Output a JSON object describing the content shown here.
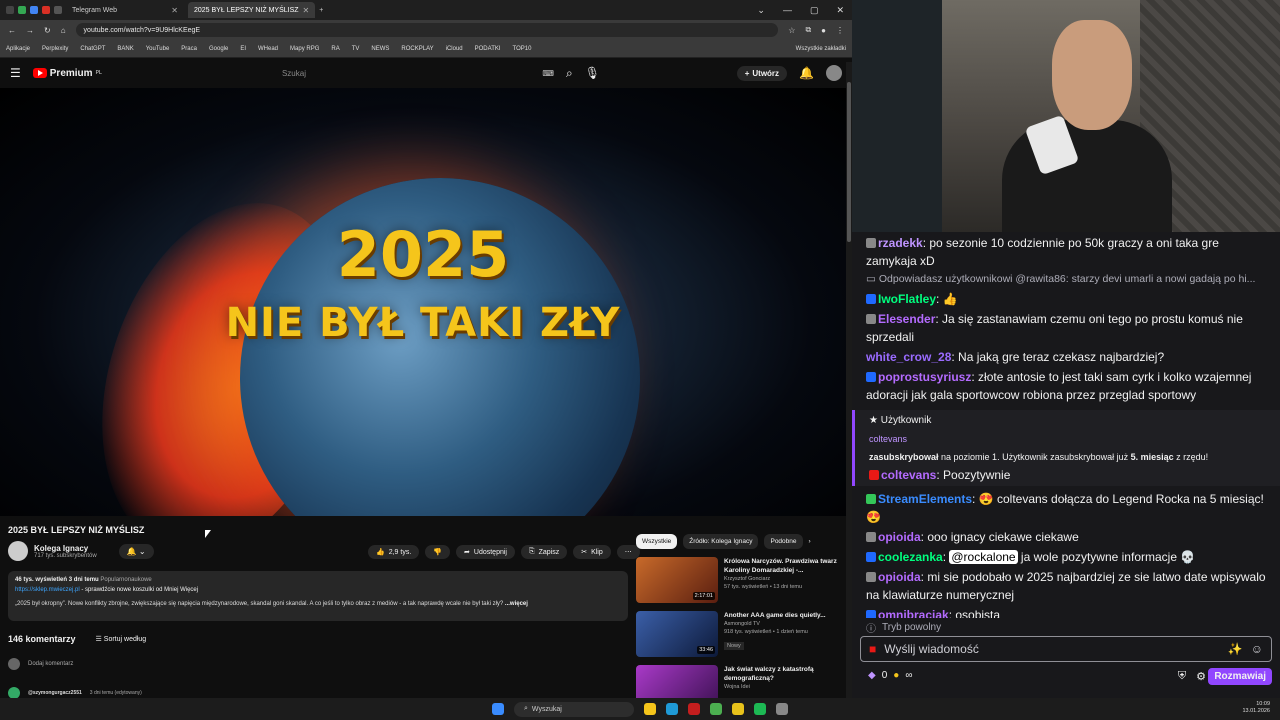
{
  "browser": {
    "tabs": [
      {
        "label": ""
      },
      {
        "label": ""
      },
      {
        "label": ""
      },
      {
        "label": ""
      },
      {
        "label": "Telegram Web"
      },
      {
        "label": "2025 BYŁ LEPSZY NIŻ MYŚLISZ"
      }
    ],
    "url": "youtube.com/watch?v=9U9HlcKEegE",
    "bookmarks": [
      "Aplikacje",
      "Perplexity",
      "ChatGPT",
      "BANK",
      "YouTube",
      "Praca",
      "Google",
      "EI",
      "WHead",
      "Mapy RPG",
      "RA",
      "TV",
      "NEWS",
      "ROCKPLAY",
      "iCloud",
      "PODATKI",
      "TOP10"
    ],
    "bookmarks_right": "Wszystkie zakładki"
  },
  "youtube": {
    "logo": "Premium",
    "logo_sup": "PL",
    "search_placeholder": "Szukaj",
    "create_label": "Utwórz",
    "video_text_1": "2025",
    "video_text_2": "NIE BYŁ TAKI ZŁY",
    "title": "2025 BYŁ LEPSZY NIŻ MYŚLISZ",
    "channel": "Kolega Ignacy",
    "subs": "717 tys. subskrybentów",
    "likes": "2,9 tys.",
    "share": "Udostępnij",
    "save": "Zapisz",
    "clip": "Klip",
    "views": "46 tys. wyświetleń  3 dni temu",
    "category": "Popularnonaukowe",
    "desc_link": "https://sklep.mwieczej.pl",
    "desc_link_rest": " - sprawdźcie nowe koszulki od Mniej Więcej",
    "desc_text": "„2025 był okropny”. Nowe konflikty zbrojne, zwiększające się napięcia międzynarodowe, skandal goni skandal. A co jeśli to tylko obraz z mediów - a tak naprawdę wcale nie był taki zły?",
    "desc_more": "...więcej",
    "comments_count": "146 komentarzy",
    "sort_label": "Sortuj według",
    "add_comment": "Dodaj komentarz",
    "first_comment_user": "@szymongurgacz2551",
    "first_comment_meta": "3 dni temu (edytowany)",
    "chips": [
      "Wszystkie",
      "Źródło: Kolega Ignacy",
      "Podobne"
    ],
    "related": [
      {
        "title": "Królowa Narcyzów. Prawdziwa twarz Karoliny Domaradzkiej -...",
        "channel": "Krzysztof Gonciarz",
        "meta": "57 tys. wyświetleń • 13 dni temu",
        "badge": "",
        "duration": "2:17:01",
        "color": "#7a3b1e"
      },
      {
        "title": "Another AAA game dies quietly...",
        "channel": "Asmongold TV",
        "meta": "918 tys. wyświetleń • 1 dzień temu",
        "badge": "Nowy",
        "duration": "33:46",
        "color": "#2a3f6a"
      },
      {
        "title": "Jak świat walczy z katastrofą demograficzną?",
        "channel": "Wojna Idei",
        "meta": "",
        "badge": "",
        "duration": "",
        "color": "#6a2a7a"
      }
    ]
  },
  "chat": {
    "messages": [
      {
        "user": "rzadekk",
        "color": "#bf94ff",
        "text": ": po sezonie 10 codziennie po 50k graczy a oni taka gre zamykaja xD",
        "badge": "#888888"
      },
      {
        "reply": "Odpowiadasz użytkownikowi @rawita86: starzy devi umarli a nowi gadają po hi..."
      },
      {
        "user": "IwoFlatley",
        "color": "#00ff7f",
        "text": ": 👍",
        "badge": "#1f69ff"
      },
      {
        "user": "Elesender",
        "color": "#b46bff",
        "text": ": Ja się zastanawiam czemu oni tego po prostu komuś nie sprzedali",
        "badge": "#888888"
      },
      {
        "user": "white_crow_28",
        "color": "#9a6bff",
        "text": ": Na jaką gre teraz czekasz najbardziej?",
        "badge": ""
      },
      {
        "user": "poprostusyriusz",
        "color": "#b46bff",
        "text": ": złote antosie to jest taki sam cyrk i kolko wzajemnej adoracji jak gala sportowcow robiona przez przeglad sportowy",
        "badge": "#1f69ff"
      }
    ],
    "sub": {
      "label": "Użytkownik",
      "user": "coltevans",
      "text_bold": "zasubskrybował",
      "text": " na poziomie 1. Użytkownik zasubskrybował już ",
      "months": "5. miesiąc",
      "tail": " z rzędu!",
      "msg_user": "coltevans",
      "msg": ": Poozytywnie"
    },
    "messages2": [
      {
        "user": "StreamElements",
        "color": "#3a8cff",
        "text": ": 😍 coltevans dołącza do Legend Rocka na 5 miesiąc! 😍",
        "badge": "#34c759"
      },
      {
        "user": "opioida",
        "color": "#b46bff",
        "text": ": ooo ignacy ciekawe ciekawe",
        "badge": "#888888"
      },
      {
        "user": "coolezanka",
        "color": "#00ff7f",
        "mention": "@rockalone",
        "text": " ja wole pozytywne informacje 💀",
        "badge": "#1f69ff"
      },
      {
        "user": "opioida",
        "color": "#b46bff",
        "text": ": mi sie podobało w 2025 najbardziej ze sie latwo date wpisywalo na klawiaturze numerycznej",
        "badge": "#888888"
      },
      {
        "user": "omnibraciak",
        "color": "#b46bff",
        "text": ": osobista",
        "badge": "#1f69ff"
      }
    ],
    "slow_mode": "Tryb powolny",
    "input_placeholder": "Wyślij wiadomość",
    "points": "0",
    "points_extra": "∞",
    "send_label": "Rozmawiaj"
  },
  "taskbar": {
    "search": "Wyszukaj",
    "time": "10:09",
    "date": "13.01.2026"
  }
}
